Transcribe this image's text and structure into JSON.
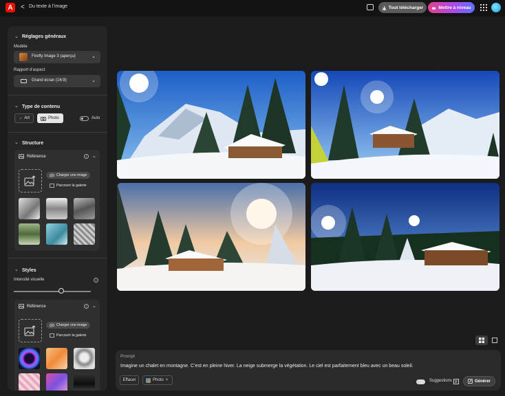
{
  "topbar": {
    "app_logo": "A",
    "back_glyph": "<",
    "breadcrumb": "Du texte à l’image",
    "download_label": "Tout télécharger",
    "upgrade_label": "Mettre à niveau"
  },
  "panel": {
    "general_title": "Réglages généraux",
    "model_label": "Modèle",
    "model_value": "Firefly Image 3 (aperçu)",
    "aspect_label": "Rapport d’aspect",
    "aspect_value": "Grand écran (16:9)",
    "content_title": "Type de contenu",
    "art_label": "Art",
    "photo_label": "Photo",
    "auto_label": "Auto",
    "structure_title": "Structure",
    "structure_ref_label": "Référence",
    "upload_label": "Charger une image",
    "browse_label": "Parcourir la galerie",
    "styles_title": "Styles",
    "intensity_label": "Intensité visuelle",
    "intensity_value": 0.62,
    "styles_ref_label": "Référence",
    "styles_upload_label": "Charger une image",
    "styles_browse_label": "Parcourir la galerie",
    "info_glyph": "i"
  },
  "prompt": {
    "label": "Prompt",
    "text": "Imagine un chalet en montagne. C’est en pleine hiver. La neige submerge la végétation. Le ciel est parfaitement bleu avec un beau soleil.",
    "clear_label": "Effacer",
    "chip_label": "Photo",
    "chip_close": "×",
    "suggestions_label": "Suggestions",
    "generate_label": "Générer"
  },
  "colors": {
    "accent": "#eb1000",
    "upgrade_gradient_start": "#e63e8c",
    "upgrade_gradient_end": "#5a72ff"
  }
}
